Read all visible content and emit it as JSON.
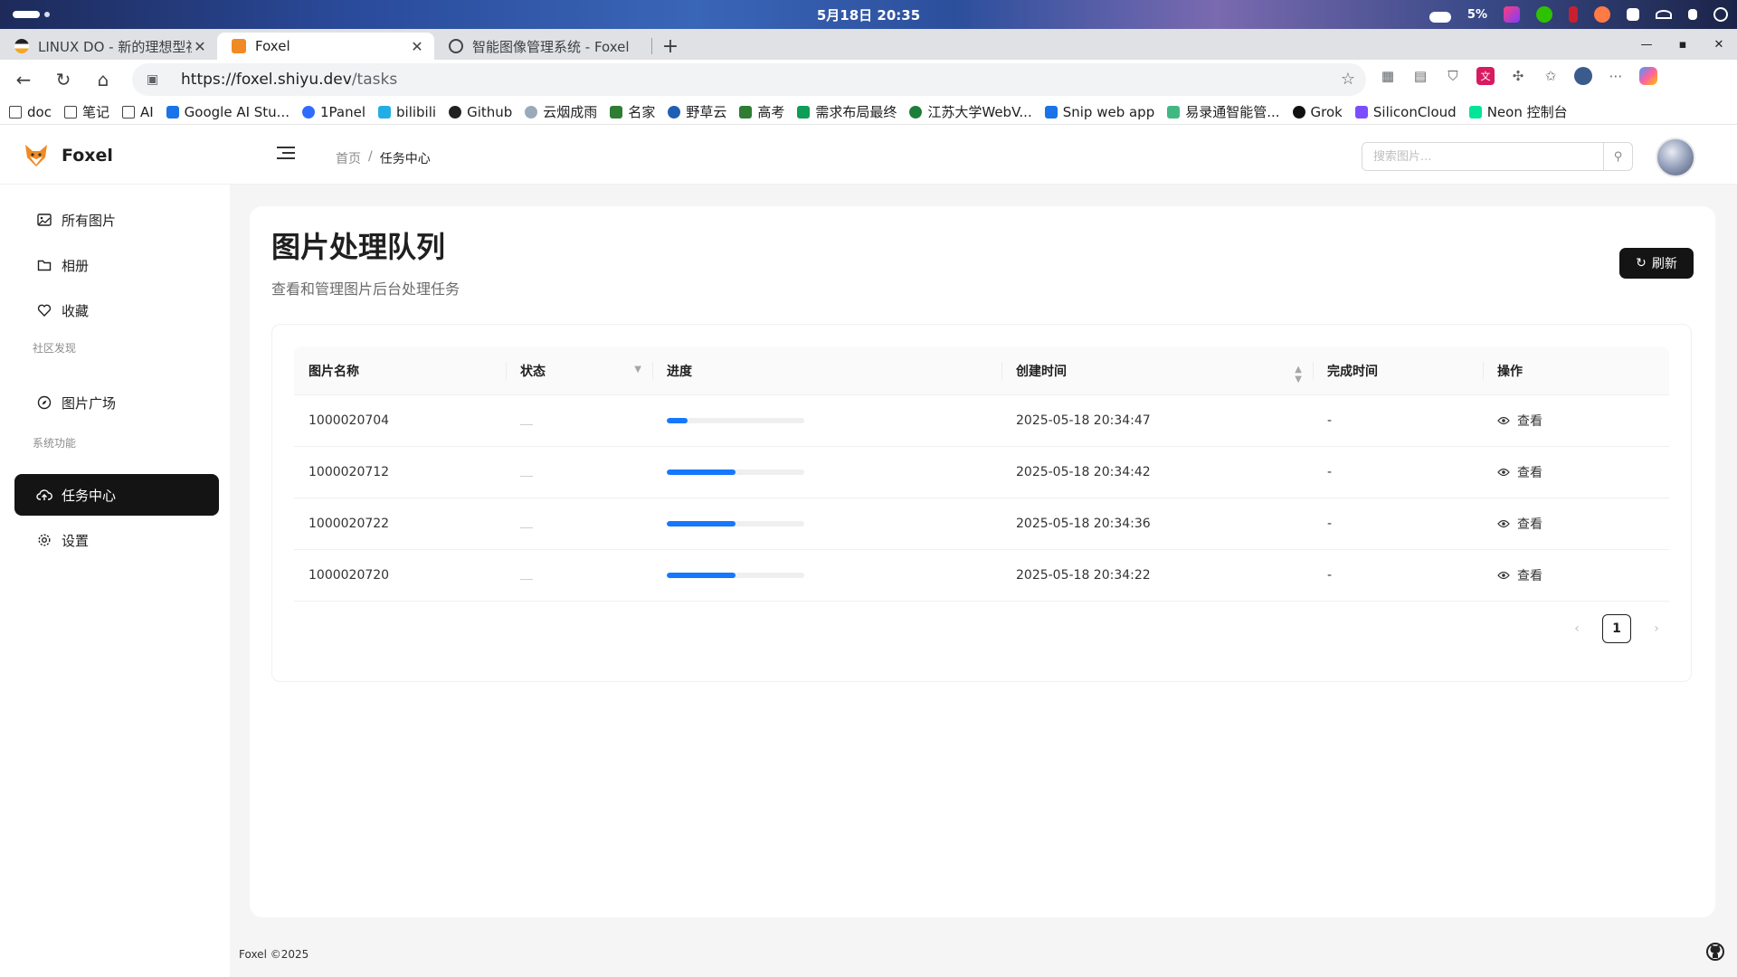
{
  "os": {
    "clock": "5月18日  20:35",
    "battery": "5%"
  },
  "browser": {
    "tabs": [
      {
        "title": "LINUX DO - 新的理想型社",
        "active": false
      },
      {
        "title": "Foxel",
        "active": true
      },
      {
        "title": "智能图像管理系统 - Foxel",
        "active": false
      }
    ],
    "url_host": "https://foxel.shiyu.dev",
    "url_path": "/tasks",
    "bookmarks": [
      "doc",
      "笔记",
      "AI",
      "Google AI Stu...",
      "1Panel",
      "bilibili",
      "Github",
      "云烟成雨",
      "名家",
      "野草云",
      "高考",
      "需求布局最终",
      "江苏大学WebV...",
      "Snip web app",
      "易录通智能管...",
      "Grok",
      "SiliconCloud",
      "Neon 控制台"
    ]
  },
  "app": {
    "brand": "Foxel",
    "breadcrumb": {
      "home": "首页",
      "sep": "/",
      "current": "任务中心"
    },
    "search_placeholder": "搜索图片...",
    "sidebar": {
      "all_images": "所有图片",
      "albums": "相册",
      "favorites": "收藏",
      "group_community": "社区发现",
      "gallery": "图片广场",
      "group_system": "系统功能",
      "tasks": "任务中心",
      "settings": "设置"
    },
    "page": {
      "title": "图片处理队列",
      "subtitle": "查看和管理图片后台处理任务",
      "refresh": "刷新"
    },
    "table": {
      "headers": {
        "name": "图片名称",
        "status": "状态",
        "progress": "进度",
        "created": "创建时间",
        "completed": "完成时间",
        "actions": "操作"
      },
      "rows": [
        {
          "name": "1000020704",
          "progress": 0.15,
          "created": "2025-05-18 20:34:47",
          "completed": "-",
          "action": "查看"
        },
        {
          "name": "1000020712",
          "progress": 0.5,
          "created": "2025-05-18 20:34:42",
          "completed": "-",
          "action": "查看"
        },
        {
          "name": "1000020722",
          "progress": 0.5,
          "created": "2025-05-18 20:34:36",
          "completed": "-",
          "action": "查看"
        },
        {
          "name": "1000020720",
          "progress": 0.5,
          "created": "2025-05-18 20:34:22",
          "completed": "-",
          "action": "查看"
        }
      ]
    },
    "pagination": {
      "current": "1"
    },
    "footer": "Foxel ©2025"
  },
  "colors": {
    "accent": "#1677ff",
    "dark": "#141414",
    "progress_track": "#efefef"
  }
}
